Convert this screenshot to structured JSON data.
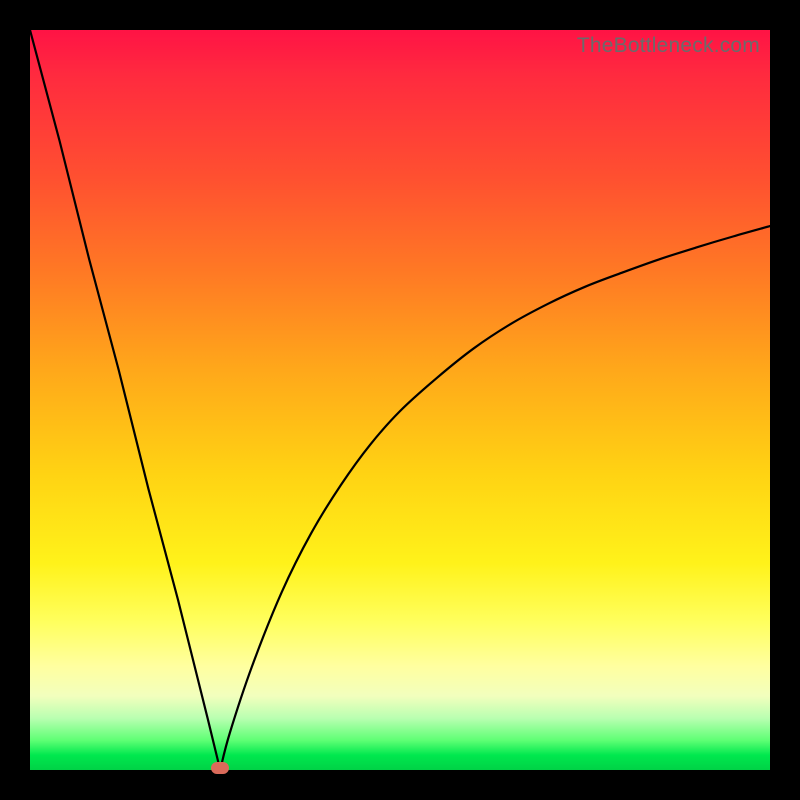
{
  "watermark": "TheBottleneck.com",
  "colors": {
    "frame": "#000000",
    "curve": "#000000",
    "marker": "#d96a5a",
    "gradient_stops": [
      "#ff1345",
      "#ff2a3f",
      "#ff5030",
      "#ff7a24",
      "#ffa81a",
      "#ffd313",
      "#fff21a",
      "#ffff5e",
      "#ffffa0",
      "#f2ffbd",
      "#b9ffb1",
      "#5eff74",
      "#00e84e",
      "#00d246"
    ]
  },
  "chart_data": {
    "type": "line",
    "title": "",
    "xlabel": "",
    "ylabel": "",
    "xlim": [
      0,
      100
    ],
    "ylim": [
      0,
      100
    ],
    "grid": false,
    "notes": "Bottleneck-style curve: steep linear descent from top-left to a minimum near x≈26, then asymptotic rise toward ~74 at right edge.",
    "series": [
      {
        "name": "bottleneck-curve",
        "x": [
          0,
          4,
          8,
          12,
          16,
          20,
          24,
          25.7,
          27,
          30,
          34,
          38,
          42,
          46,
          50,
          55,
          60,
          65,
          70,
          75,
          80,
          85,
          90,
          95,
          100
        ],
        "values": [
          100,
          85,
          69,
          54,
          38,
          23,
          7,
          0,
          5,
          14,
          24,
          32,
          38.5,
          44,
          48.5,
          53,
          57,
          60.3,
          63,
          65.3,
          67.2,
          69,
          70.6,
          72.1,
          73.5
        ]
      }
    ],
    "marker": {
      "x": 25.7,
      "y": 0
    }
  }
}
